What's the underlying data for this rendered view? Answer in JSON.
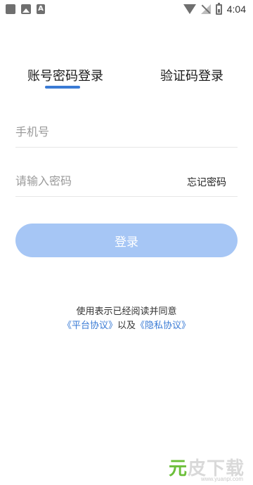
{
  "status_bar": {
    "time": "4:04",
    "left_icons": [
      "app-icon",
      "image-icon",
      "a-icon"
    ],
    "a_label": "A",
    "right_icons": [
      "wifi-icon",
      "no-signal-icon",
      "battery-icon"
    ]
  },
  "tabs": {
    "password_login": "账号密码登录",
    "code_login": "验证码登录",
    "active": "password_login",
    "indicator_color": "#3a7bd5"
  },
  "form": {
    "phone_placeholder": "手机号",
    "phone_value": "",
    "password_placeholder": "请输入密码",
    "password_value": "",
    "forgot_label": "忘记密码",
    "login_label": "登录",
    "login_color": "#a6c6f5"
  },
  "agreement": {
    "text": "使用表示已经阅读并同意",
    "platform_link": "《平台协议》",
    "connector": "以及",
    "privacy_link": "《隐私协议》",
    "link_color": "#3a7bd5"
  },
  "watermark": {
    "brand_a": "元",
    "brand_b": "皮下载",
    "url": "www.yuanpi.com"
  }
}
